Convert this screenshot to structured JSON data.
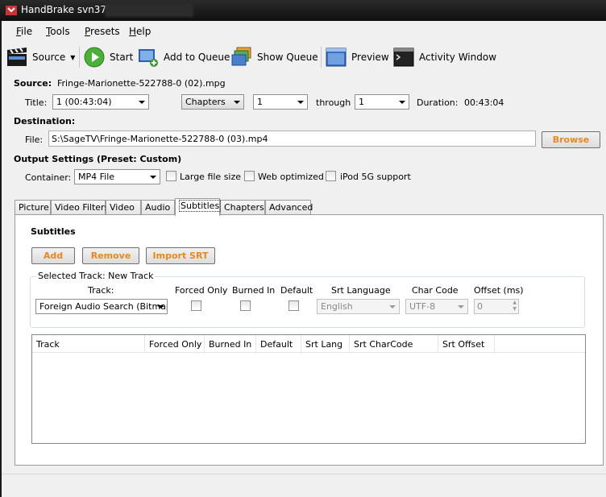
{
  "window": {
    "title": "HandBrake svn3707"
  },
  "menu": [
    "File",
    "Tools",
    "Presets",
    "Help"
  ],
  "toolbar": {
    "source": "Source",
    "start": "Start",
    "add_to_queue": "Add to Queue",
    "show_queue": "Show Queue",
    "preview": "Preview",
    "activity_window": "Activity Window"
  },
  "source": {
    "label": "Source:",
    "value": "Fringe-Marionette-522788-0 (02).mpg",
    "title_label": "Title:",
    "title_value": "1 (00:43:04)",
    "range_type": "Chapters",
    "range_start": "1",
    "through_label": "through",
    "range_end": "1",
    "duration_label": "Duration:",
    "duration_value": "00:43:04"
  },
  "destination": {
    "label": "Destination:",
    "file_label": "File:",
    "file_value": "S:\\SageTV\\Fringe-Marionette-522788-0 (03).mp4",
    "browse": "Browse"
  },
  "output": {
    "label": "Output Settings (Preset: Custom)",
    "container_label": "Container:",
    "container_value": "MP4 File",
    "large_file": "Large file size",
    "web_optimized": "Web optimized",
    "ipod": "iPod 5G support"
  },
  "tabs": [
    "Picture",
    "Video Filters",
    "Video",
    "Audio",
    "Subtitles",
    "Chapters",
    "Advanced"
  ],
  "subtitles": {
    "heading": "Subtitles",
    "add": "Add",
    "remove": "Remove",
    "import_srt": "Import SRT",
    "selected_track": "Selected Track: New Track",
    "track_label": "Track:",
    "track_value": "Foreign Audio Search (Bitmap",
    "forced_only": "Forced Only",
    "burned_in": "Burned In",
    "default": "Default",
    "srt_language_label": "Srt Language",
    "srt_language_value": "English",
    "char_code_label": "Char Code",
    "char_code_value": "UTF-8",
    "offset_label": "Offset (ms)",
    "offset_value": "0",
    "columns": [
      "Track",
      "Forced Only",
      "Burned In",
      "Default",
      "Srt Lang",
      "Srt CharCode",
      "Srt Offset"
    ]
  }
}
